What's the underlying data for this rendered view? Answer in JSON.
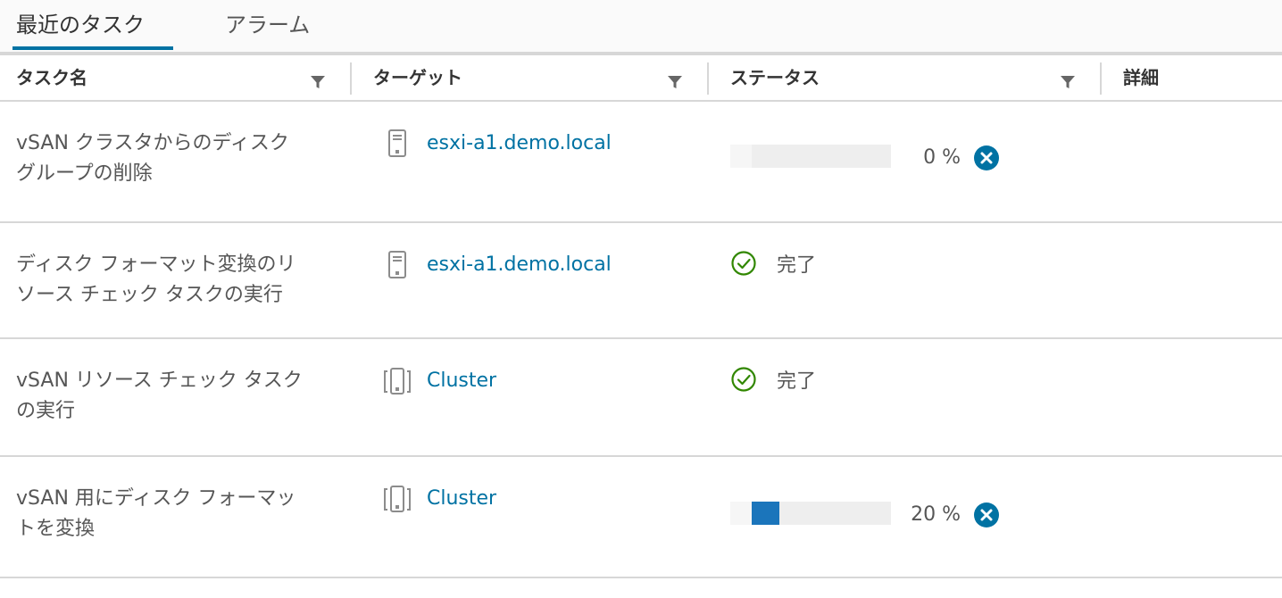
{
  "tabs": [
    {
      "label": "最近のタスク",
      "active": true
    },
    {
      "label": "アラーム",
      "active": false
    }
  ],
  "columns": {
    "task_name": "タスク名",
    "target": "ターゲット",
    "status": "ステータス",
    "details": "詳細"
  },
  "rows": [
    {
      "name_line1": "vSAN クラスタからのディスク",
      "name_line2": "グループの削除",
      "target": "esxi-a1.demo.local",
      "target_icon": "host-icon",
      "progress": 0,
      "progress_label": "0 %"
    },
    {
      "name_line1": "ディスク フォーマット変換のリ",
      "name_line2": "ソース チェック タスクの実行",
      "target": "esxi-a1.demo.local",
      "target_icon": "host-icon",
      "status": "完了"
    },
    {
      "name_line1": "vSAN リソース チェック タスク",
      "name_line2": "の実行",
      "target": "Cluster",
      "target_icon": "cluster-icon",
      "status": "完了"
    },
    {
      "name_line1": "vSAN 用にディスク フォーマッ",
      "name_line2": "トを変換",
      "target": "Cluster",
      "target_icon": "cluster-icon",
      "progress": 0.2,
      "progress_label": "20 %"
    }
  ],
  "colors": {
    "link": "#0072a3",
    "progress": "#1b75bb",
    "success": "#318700",
    "cancel": "#0072a3"
  }
}
